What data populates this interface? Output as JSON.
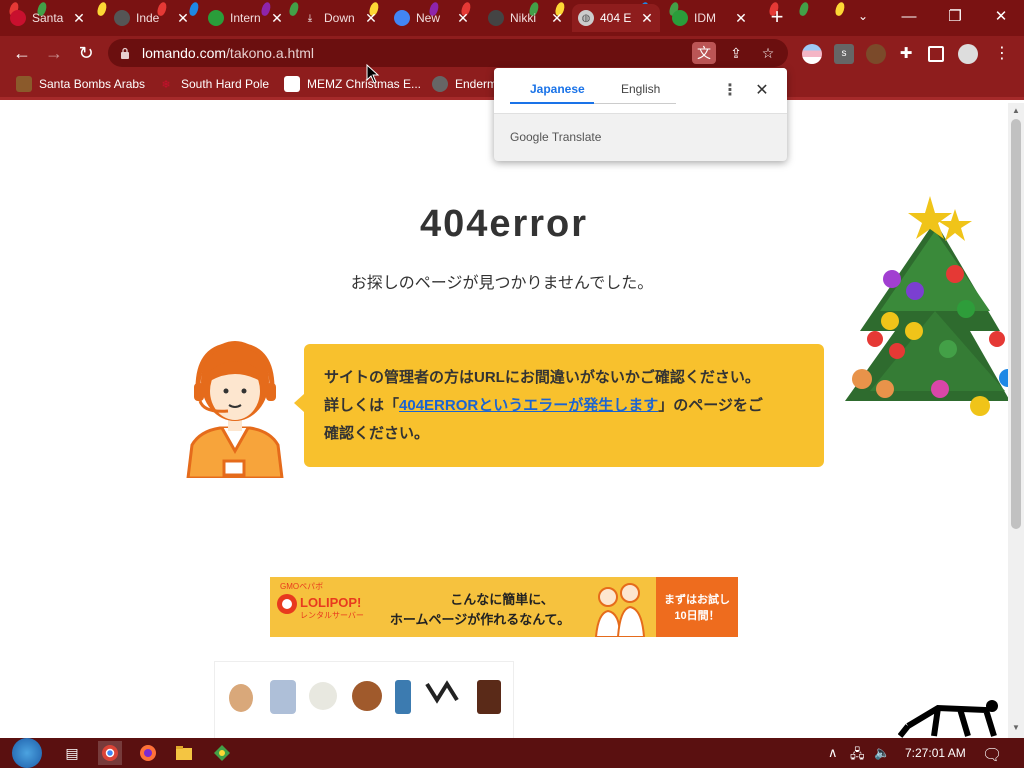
{
  "browser": {
    "tabs": [
      {
        "title": "Santa",
        "favicon_color": "#c8102e",
        "active": false
      },
      {
        "title": "Inde",
        "favicon_color": "#555555",
        "active": false
      },
      {
        "title": "Intern",
        "favicon_color": "#2a9d3a",
        "active": false
      },
      {
        "title": "Down",
        "favicon_color": "#ffffff",
        "active": false
      },
      {
        "title": "New",
        "favicon_color": "#4285f4",
        "active": false
      },
      {
        "title": "Nikki",
        "favicon_color": "#444444",
        "active": false
      },
      {
        "title": "404 E",
        "favicon_color": "#cccccc",
        "active": true
      },
      {
        "title": "IDM",
        "favicon_color": "#2a9d3a",
        "active": false
      }
    ],
    "url_domain": "lomando.com",
    "url_path": "/takono.a.html",
    "bookmarks": [
      {
        "label": "Santa Bombs Arabs",
        "icon_color": "#8b5a2b"
      },
      {
        "label": "South Hard Pole",
        "icon_color": "#c8102e"
      },
      {
        "label": "MEMZ Christmas E...",
        "icon_color": "#ffffff"
      },
      {
        "label": "Enderm",
        "icon_color": "#666666"
      }
    ]
  },
  "translate_popup": {
    "tab_source": "Japanese",
    "tab_target": "English",
    "brand": "Google Translate"
  },
  "page": {
    "heading": "404error",
    "subheading": "お探しのページが見つかりませんでした。",
    "message_line1": "サイトの管理者の方はURLにお間違いがないかご確認ください。",
    "message_prefix": "詳しくは「",
    "message_link": "404ERRORというエラーが発生します",
    "message_suffix": "」のページをご",
    "message_line3": "確認ください。",
    "banner": {
      "logo": "GMOペパボ",
      "brand": "LOLIPOP!",
      "brand_sub": "レンタルサーバー",
      "line1": "こんなに簡単に、",
      "line2": "ホームページが作れるなんて。",
      "cta_line1": "まずはお試し",
      "cta_line2": "10日間！"
    }
  },
  "taskbar": {
    "clock": "7:27:01 AM"
  },
  "colors": {
    "browser_frame": "#8e1d1d",
    "bubble": "#f8c12d",
    "link": "#1b64d2",
    "banner_yellow": "#f6c23e",
    "banner_orange": "#ee6c1e"
  }
}
